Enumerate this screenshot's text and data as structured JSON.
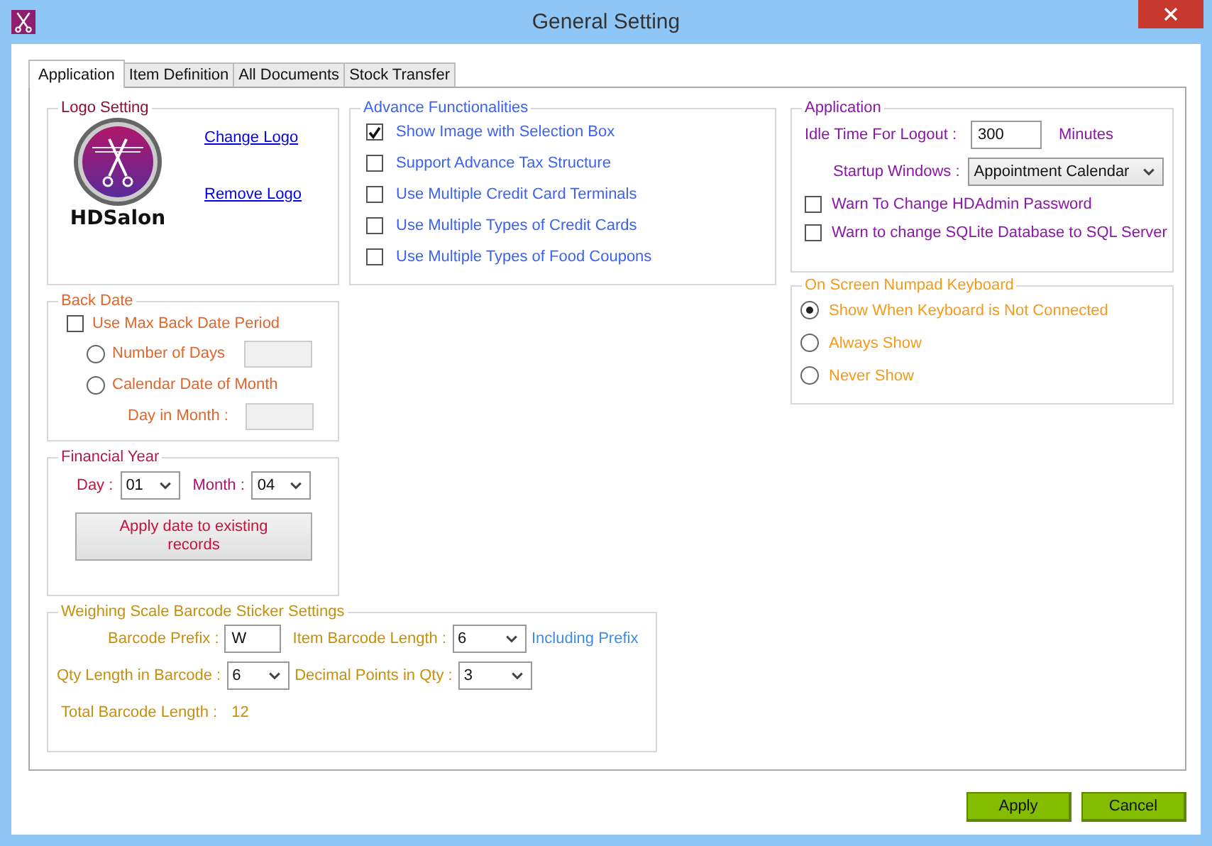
{
  "window": {
    "title": "General Setting"
  },
  "tabs": [
    {
      "label": "Application",
      "selected": true
    },
    {
      "label": "Item Definition",
      "selected": false
    },
    {
      "label": "All Documents",
      "selected": false
    },
    {
      "label": "Stock Transfer",
      "selected": false
    }
  ],
  "logo_setting": {
    "title": "Logo Setting",
    "logo_text": "HDSalon",
    "links": [
      "Change Logo",
      "Remove Logo"
    ]
  },
  "advance_functionalities": {
    "title": "Advance Functionalities",
    "options": [
      {
        "label": "Show Image with Selection Box",
        "checked": true
      },
      {
        "label": "Support Advance Tax Structure",
        "checked": false
      },
      {
        "label": "Use Multiple Credit Card Terminals",
        "checked": false
      },
      {
        "label": "Use Multiple Types of Credit Cards",
        "checked": false
      },
      {
        "label": "Use Multiple Types of Food Coupons",
        "checked": false
      }
    ]
  },
  "back_date": {
    "title": "Back Date",
    "use_max": {
      "label": "Use Max Back Date Period",
      "checked": false
    },
    "options": [
      {
        "label": "Number of Days",
        "selected": false
      },
      {
        "label": "Calendar Date of Month",
        "selected": false
      }
    ],
    "day_in_month_label": "Day in Month :"
  },
  "financial_year": {
    "title": "Financial Year",
    "day_label": "Day :",
    "day": "01",
    "month_label": "Month :",
    "month": "04",
    "apply_button": "Apply date to existing records"
  },
  "weighing_scale": {
    "title": "Weighing Scale Barcode Sticker Settings",
    "barcode_prefix_label": "Barcode Prefix :",
    "barcode_prefix": "W",
    "item_length_label": "Item Barcode Length :",
    "item_length": "6",
    "including_prefix": "Including Prefix",
    "qty_length_label": "Qty Length in Barcode :",
    "qty_length": "6",
    "decimal_label": "Decimal Points in Qty :",
    "decimal": "3",
    "total_label": "Total Barcode Length :",
    "total": "12"
  },
  "application": {
    "title": "Application",
    "idle_label": "Idle Time For Logout :",
    "idle_value": "300",
    "idle_unit": "Minutes",
    "startup_label": "Startup Windows :",
    "startup_value": "Appointment Calendar",
    "warnings": [
      {
        "label": "Warn To Change HDAdmin Password",
        "checked": false
      },
      {
        "label": "Warn to change SQLite Database to SQL Server",
        "checked": false
      }
    ]
  },
  "numpad_keyboard": {
    "title": "On Screen Numpad Keyboard",
    "options": [
      {
        "label": "Show When Keyboard is Not Connected",
        "selected": true
      },
      {
        "label": "Always Show",
        "selected": false
      },
      {
        "label": "Never Show",
        "selected": false
      }
    ]
  },
  "buttons": [
    "Apply",
    "Cancel"
  ]
}
